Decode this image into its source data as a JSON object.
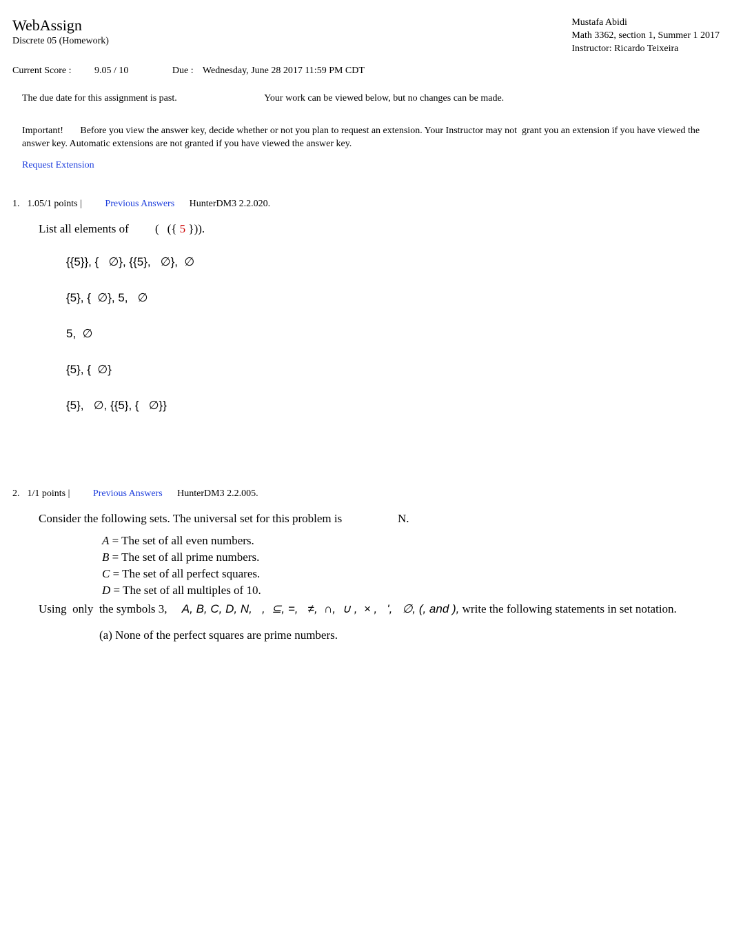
{
  "header": {
    "brand": "WebAssign",
    "assignment": "Discrete 05 (Homework)",
    "student": "Mustafa Abidi",
    "course": "Math 3362, section 1, Summer 1 2017",
    "instructor_lbl": "Instructor: ",
    "instructor": "Ricardo Teixeira"
  },
  "score": {
    "lbl": "Current Score :",
    "val": "9.05 / 10",
    "due_lbl": "Due :",
    "due_val": "Wednesday, June 28 2017 11:59 PM CDT"
  },
  "banner": {
    "past": "The due date for this assignment is past.",
    "view": "Your work can be viewed below, but no changes can be made."
  },
  "notice": {
    "lead": "Important!",
    "body": "Before you view the answer key, decide whether or not you plan to request an extension. Your Instructor may not  grant you an extension if you have viewed the answer key. Automatic extensions are not granted if you have viewed the answer key."
  },
  "ext_link": "Request Extension",
  "q1": {
    "num": "1.",
    "pts": "1.05/1 points |",
    "prev": "Previous Answers",
    "ref": "HunterDM3 2.2.020.",
    "prompt_a": "List all elements of ",
    "prompt_b": "(   ({ ",
    "prompt_c": "5",
    "prompt_d": " })).",
    "ans1": "{{5}}, {   ∅}, {{5},   ∅},  ∅",
    "ans2": "{5}, {  ∅}, 5,   ∅",
    "ans3": "5,  ∅",
    "ans4": "{5}, {  ∅}",
    "ans5": "{5},   ∅, {{5}, {   ∅}}"
  },
  "q2": {
    "num": "2.",
    "pts": "1/1 points |",
    "prev": "Previous Answers",
    "ref": "HunterDM3 2.2.005.",
    "intro_a": "Consider the following sets. The universal set for this problem is ",
    "intro_b": "N",
    "intro_c": ".",
    "defA_l": "A",
    "defA_r": " = The set of all even numbers.",
    "defB_l": "B",
    "defB_r": " = The set of all prime numbers.",
    "defC_l": "C",
    "defC_r": " = The set of all perfect squares.",
    "defD_l": "D",
    "defD_r": " = The set of all multiples of 10.",
    "using_a": "Using  only  the symbols 3,     ",
    "using_b": "A, B, C, D, N,   ,  ⊆, =,   ≠,  ∩,  ∪ ,  × ,   ',   ∅, (, and ),",
    "using_c": " write the following statements in set notation.",
    "sub_a": "(a) None of the perfect squares are prime numbers."
  }
}
